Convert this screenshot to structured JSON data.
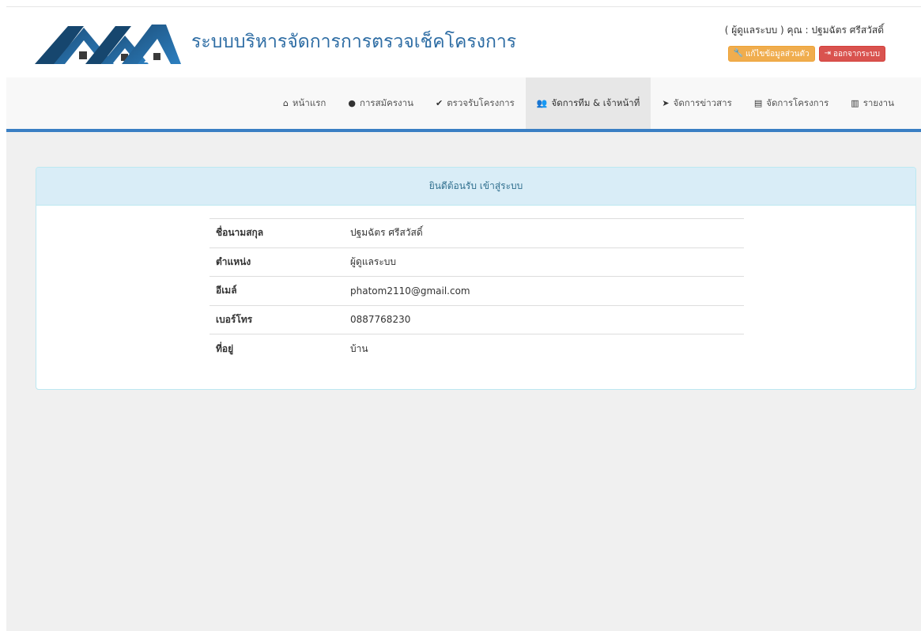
{
  "header": {
    "title": "ระบบบริหารจัดการการตรวจเช็คโครงการ",
    "user_line": "( ผู้ดูแลระบบ ) คุณ : ปฐมฉัตร ศรีสวัสดิ์",
    "edit_profile_label": "แก้ไขข้อมูลส่วนตัว",
    "logout_label": "ออกจากระบบ"
  },
  "nav": {
    "items": [
      {
        "label": "หน้าแรก",
        "icon": "home-icon"
      },
      {
        "label": "การสมัครงาน",
        "icon": "user-icon"
      },
      {
        "label": "ตรวจรับโครงการ",
        "icon": "check-icon"
      },
      {
        "label": "จัดการทีม & เจ้าหน้าที่",
        "icon": "users-icon"
      },
      {
        "label": "จัดการข่าวสาร",
        "icon": "send-icon"
      },
      {
        "label": "จัดการโครงการ",
        "icon": "file-icon"
      },
      {
        "label": "รายงาน",
        "icon": "bar-chart-icon"
      }
    ],
    "active_index": 3
  },
  "panel": {
    "heading": "ยินดีต้อนรับ เข้าสู่ระบบ",
    "rows": [
      {
        "label": "ชื่อนามสกุล",
        "value": "ปฐมฉัตร ศรีสวัสดิ์"
      },
      {
        "label": "ตำแหน่ง",
        "value": "ผู้ดูแลระบบ"
      },
      {
        "label": "อีเมล์",
        "value": "phatom2110@gmail.com"
      },
      {
        "label": "เบอร์โทร",
        "value": "0887768230"
      },
      {
        "label": "ที่อยู่",
        "value": "บ้าน"
      }
    ]
  },
  "colors": {
    "brand": "#2e6da4",
    "nav_border": "#3a7fc4",
    "warning": "#f0ad4e",
    "danger": "#d9534f",
    "panel_heading_bg": "#d9edf7"
  }
}
